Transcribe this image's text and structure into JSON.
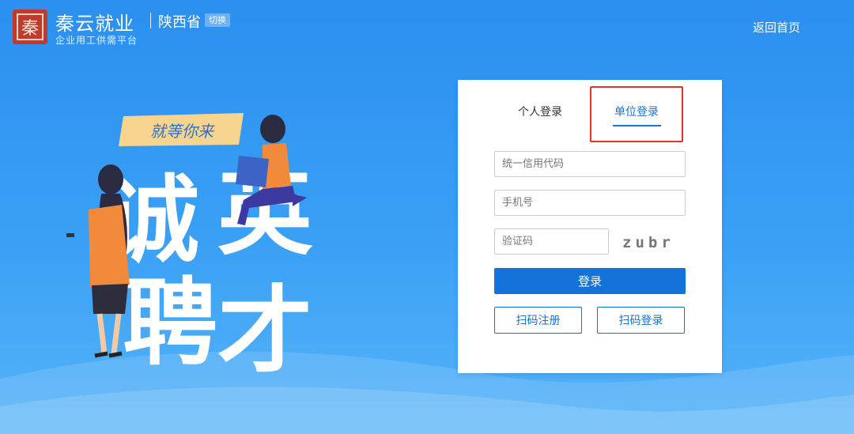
{
  "header": {
    "logo_glyph": "秦",
    "title": "秦云就业",
    "subtitle": "企业用工供需平台",
    "province": "陕西省",
    "switch_label": "切换",
    "back_home": "返回首页"
  },
  "banner": {
    "slogan": "就等你来",
    "headline": [
      "诚",
      "英",
      "聘",
      "才"
    ]
  },
  "login": {
    "tabs": [
      {
        "label": "个人登录",
        "active": false
      },
      {
        "label": "单位登录",
        "active": true
      }
    ],
    "credit_code_placeholder": "统一信用代码",
    "phone_placeholder": "手机号",
    "captcha_placeholder": "验证码",
    "captcha_text": "zubr",
    "login_button": "登录",
    "scan_register_button": "扫码注册",
    "scan_login_button": "扫码登录"
  },
  "colors": {
    "background": "#2b8fef",
    "primary": "#1572d8",
    "highlight": "#e5322d"
  }
}
